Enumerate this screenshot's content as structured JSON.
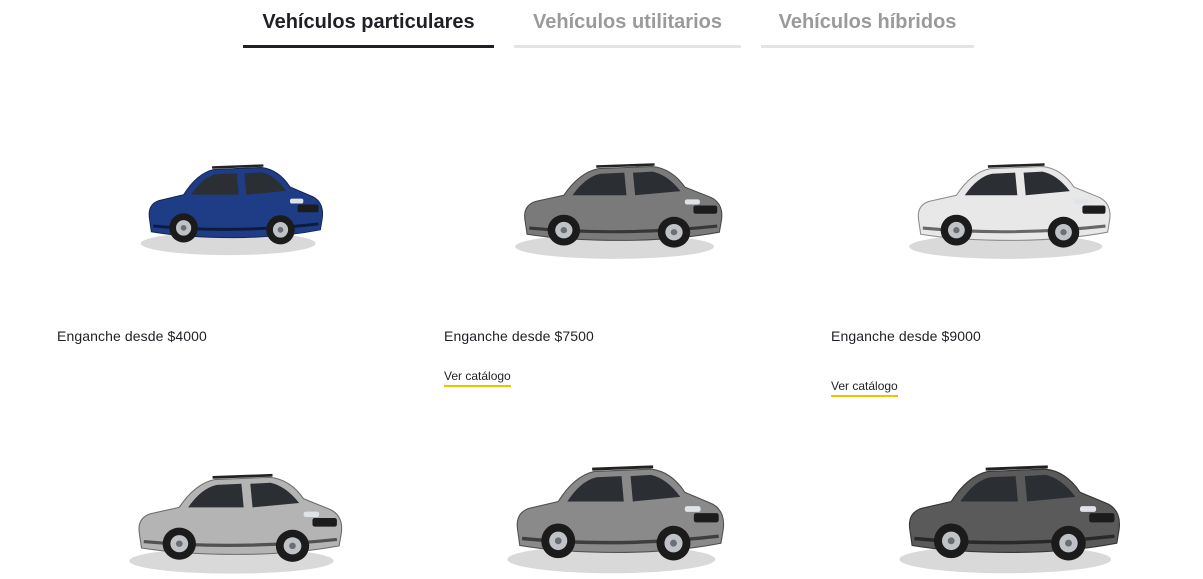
{
  "tabs": [
    {
      "label": "Vehículos particulares",
      "active": true
    },
    {
      "label": "Vehículos utilitarios",
      "active": false
    },
    {
      "label": "Vehículos híbridos",
      "active": false
    }
  ],
  "cards": [
    {
      "price": "Enganche desde $4000",
      "catalog_label": "",
      "body_color": "#1f3c87"
    },
    {
      "price": "Enganche desde $7500",
      "catalog_label": "Ver catálogo",
      "body_color": "#7a7a7a"
    },
    {
      "price": "Enganche desde $9000",
      "catalog_label": "Ver catálogo",
      "body_color": "#e8e8e8"
    },
    {
      "price": "",
      "catalog_label": "",
      "body_color": "#b4b4b4"
    },
    {
      "price": "",
      "catalog_label": "",
      "body_color": "#8a8a8a"
    },
    {
      "price": "",
      "catalog_label": "",
      "body_color": "#5a5a5a"
    }
  ],
  "colors": {
    "accent_underline": "#f2c200",
    "active_tab": "#1f2025",
    "inactive_tab": "#9a9a9a"
  }
}
